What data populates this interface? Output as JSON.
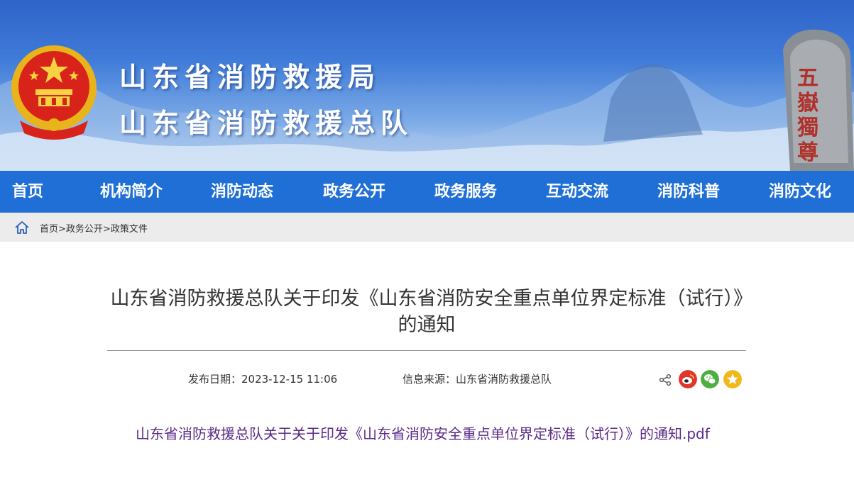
{
  "header": {
    "title_line1": "山东省消防救援局",
    "title_line2": "山东省消防救援总队",
    "rock_inscription": "五嶽獨尊"
  },
  "nav": {
    "items": [
      "首页",
      "机构简介",
      "消防动态",
      "政务公开",
      "政务服务",
      "互动交流",
      "消防科普",
      "消防文化"
    ]
  },
  "breadcrumb": {
    "home": "首页",
    "sep1": ">",
    "section": "政务公开",
    "sep2": ">",
    "current": "政策文件"
  },
  "article": {
    "title": "山东省消防救援总队关于印发《山东省消防安全重点单位界定标准（试行）》的通知",
    "publish_date": "发布日期：2023-12-15 11:06",
    "source": "信息来源：山东省消防救援总队",
    "attachment": "山东省消防救援总队关于关于印发《山东省消防安全重点单位界定标准（试行）》的通知.pdf"
  },
  "colors": {
    "nav_bg": "#1f6fd6",
    "weibo": "#e2352c",
    "wechat": "#4caf3f",
    "qzone": "#f2b81b",
    "attachment_text": "#5b2a86"
  }
}
